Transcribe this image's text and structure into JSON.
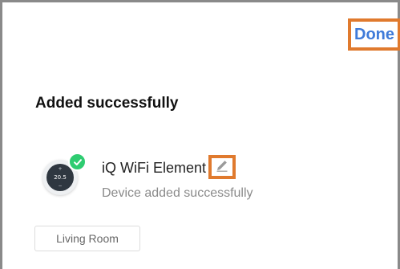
{
  "header": {
    "done_label": "Done"
  },
  "main": {
    "title": "Added successfully",
    "device": {
      "name": "iQ WiFi Element",
      "status": "Device added successfully",
      "thermostat_reading": "20.5",
      "icon": "thermostat-icon",
      "badge_icon": "check-icon",
      "edit_icon": "pencil-icon"
    },
    "room": {
      "label": "Living Room"
    }
  },
  "colors": {
    "accent": "#3f7bd9",
    "highlight_border": "#e07a2e",
    "success": "#2ecc71"
  }
}
